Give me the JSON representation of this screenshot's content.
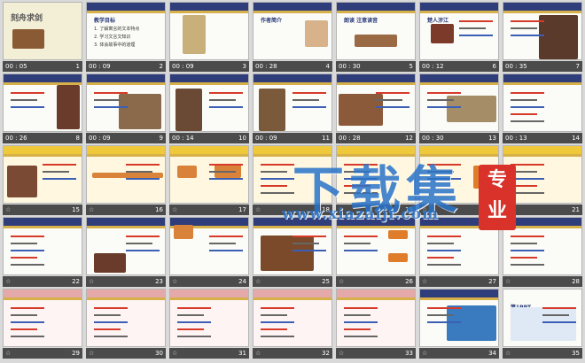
{
  "slides": [
    {
      "n": "1",
      "t": "00 : 05",
      "title": "刻舟求剑"
    },
    {
      "n": "2",
      "t": "00 : 09",
      "title": "教学目标",
      "lines": [
        "1. 了解寓言的文本特点",
        "2. 学习文言文知识",
        "3. 体会故事中的道理"
      ]
    },
    {
      "n": "3",
      "t": "00 : 09"
    },
    {
      "n": "4",
      "t": "00 : 28",
      "title": "作者简介"
    },
    {
      "n": "5",
      "t": "00 : 30",
      "title": "朗读 注意读音"
    },
    {
      "n": "6",
      "t": "00 : 12",
      "title": "楚人涉江"
    },
    {
      "n": "7",
      "t": "00 : 35"
    },
    {
      "n": "8",
      "t": "00 : 26"
    },
    {
      "n": "9",
      "t": "00 : 09"
    },
    {
      "n": "10",
      "t": "00 : 14"
    },
    {
      "n": "11",
      "t": "00 : 09"
    },
    {
      "n": "12",
      "t": "00 : 28"
    },
    {
      "n": "13",
      "t": "00 : 30"
    },
    {
      "n": "14",
      "t": "00 : 13"
    },
    {
      "n": "15",
      "t": ""
    },
    {
      "n": "16",
      "t": ""
    },
    {
      "n": "17",
      "t": ""
    },
    {
      "n": "18",
      "t": ""
    },
    {
      "n": "19",
      "t": ""
    },
    {
      "n": "20",
      "t": ""
    },
    {
      "n": "21",
      "t": ""
    },
    {
      "n": "22",
      "t": ""
    },
    {
      "n": "23",
      "t": ""
    },
    {
      "n": "24",
      "t": ""
    },
    {
      "n": "25",
      "t": ""
    },
    {
      "n": "26",
      "t": ""
    },
    {
      "n": "27",
      "t": ""
    },
    {
      "n": "28",
      "t": ""
    },
    {
      "n": "29",
      "t": ""
    },
    {
      "n": "30",
      "t": ""
    },
    {
      "n": "31",
      "t": ""
    },
    {
      "n": "32",
      "t": ""
    },
    {
      "n": "33",
      "t": ""
    },
    {
      "n": "34",
      "t": ""
    },
    {
      "n": "35",
      "t": "",
      "title": "第1PPT"
    }
  ],
  "watermark": {
    "big": "下载集",
    "url": "www.xiazaiji.com",
    "badge": "专业"
  }
}
